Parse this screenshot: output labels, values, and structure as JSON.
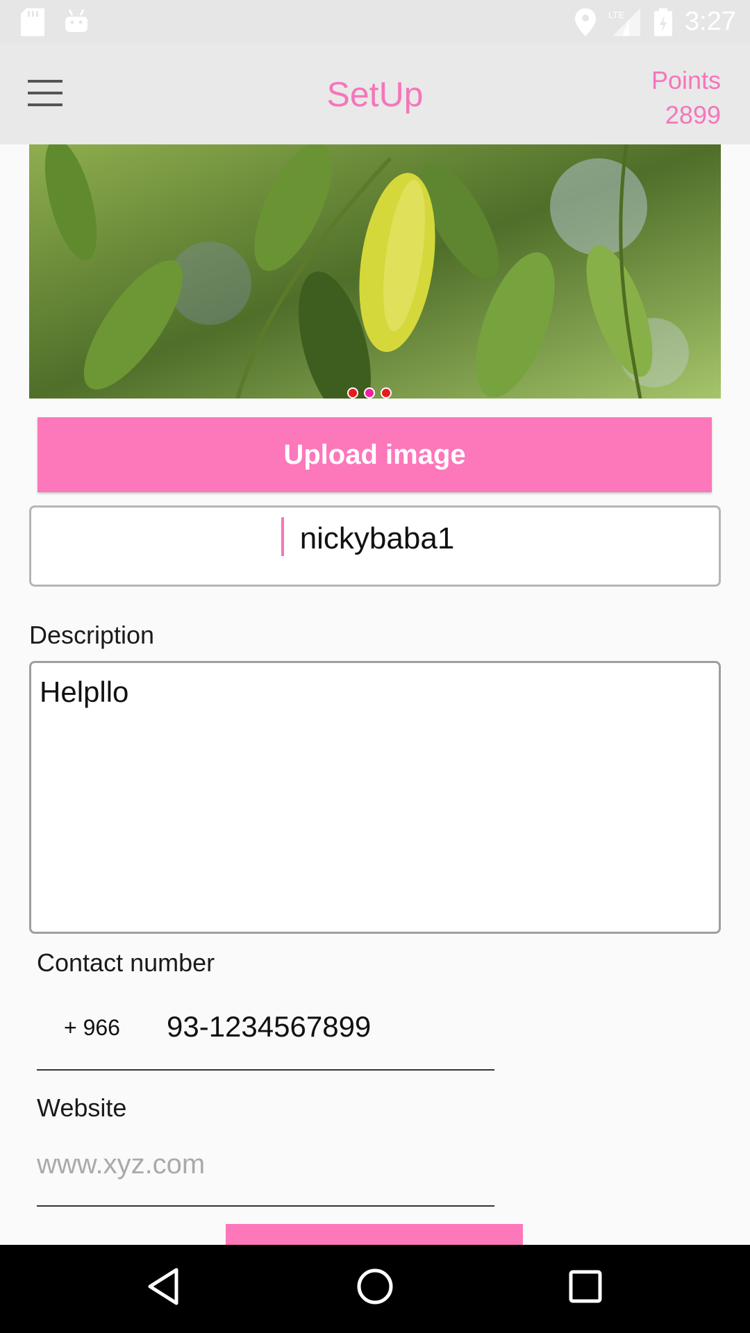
{
  "status_bar": {
    "time": "3:27",
    "icons": [
      "sd-card-icon",
      "android-icon",
      "location-icon",
      "lte-signal-icon",
      "battery-icon"
    ]
  },
  "app_bar": {
    "title": "SetUp",
    "points_label": "Points",
    "points_value": "2899",
    "menu_icon": "hamburger-menu-icon"
  },
  "carousel": {
    "total_pages": 3,
    "active_page": 2
  },
  "upload_button": {
    "label": "Upload image"
  },
  "name_field": {
    "value": "nickybaba1"
  },
  "description": {
    "label": "Description",
    "value": "Helpllo"
  },
  "contact": {
    "label": "Contact number",
    "country_code": "+ 966",
    "value": "93-1234567899"
  },
  "website": {
    "label": "Website",
    "placeholder": "www.xyz.com"
  },
  "colors": {
    "accent": "#f576b9",
    "button": "#fd77bb",
    "app_bar": "#e9e9e9"
  },
  "nav_bar": {
    "back": "back-icon",
    "home": "home-icon",
    "recents": "recents-icon"
  }
}
